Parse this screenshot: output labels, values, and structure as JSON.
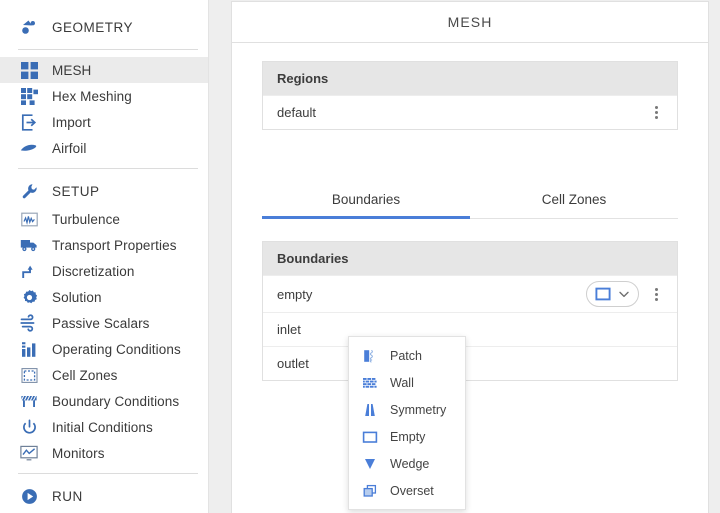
{
  "app": {
    "accent_color": "#4a7ed8",
    "icon_color": "#3a6db5",
    "highlight_color": "#ebebeb"
  },
  "sidebar": {
    "groups": [
      {
        "items": [
          {
            "label": "GEOMETRY",
            "icon": "geometry-icon",
            "section": true,
            "active": false
          }
        ]
      },
      {
        "items": [
          {
            "label": "MESH",
            "icon": "mesh-grid-icon",
            "section": false,
            "active": true
          },
          {
            "label": "Hex Meshing",
            "icon": "hex-meshing-icon",
            "section": false,
            "active": false
          },
          {
            "label": "Import",
            "icon": "import-icon",
            "section": false,
            "active": false
          },
          {
            "label": "Airfoil",
            "icon": "airfoil-icon",
            "section": false,
            "active": false
          }
        ]
      },
      {
        "items": [
          {
            "label": "SETUP",
            "icon": "wrench-icon",
            "section": true,
            "active": false
          },
          {
            "label": "Turbulence",
            "icon": "turbulence-icon",
            "section": false,
            "active": false
          },
          {
            "label": "Transport Properties",
            "icon": "truck-icon",
            "section": false,
            "active": false
          },
          {
            "label": "Discretization",
            "icon": "discretization-icon",
            "section": false,
            "active": false
          },
          {
            "label": "Solution",
            "icon": "gear-icon",
            "section": false,
            "active": false
          },
          {
            "label": "Passive Scalars",
            "icon": "wind-icon",
            "section": false,
            "active": false
          },
          {
            "label": "Operating Conditions",
            "icon": "bar-chart-icon",
            "section": false,
            "active": false
          },
          {
            "label": "Cell Zones",
            "icon": "cell-zones-icon",
            "section": false,
            "active": false
          },
          {
            "label": "Boundary Conditions",
            "icon": "barrier-icon",
            "section": false,
            "active": false
          },
          {
            "label": "Initial Conditions",
            "icon": "power-icon",
            "section": false,
            "active": false
          },
          {
            "label": "Monitors",
            "icon": "monitor-icon",
            "section": false,
            "active": false
          }
        ]
      },
      {
        "items": [
          {
            "label": "RUN",
            "icon": "play-icon",
            "section": true,
            "active": false
          }
        ]
      }
    ]
  },
  "main": {
    "title": "MESH",
    "regions_card": {
      "header": "Regions",
      "rows": [
        {
          "name": "default",
          "menu_icon": "kebab-icon"
        }
      ]
    },
    "tabs": [
      {
        "label": "Boundaries",
        "active": true
      },
      {
        "label": "Cell Zones",
        "active": false
      }
    ],
    "boundaries_card": {
      "header": "Boundaries",
      "rows": [
        {
          "name": "empty",
          "type_icon": "empty-type-icon",
          "has_select": true
        },
        {
          "name": "inlet",
          "type_icon": "",
          "has_select": false
        },
        {
          "name": "outlet",
          "type_icon": "",
          "has_select": false
        }
      ]
    },
    "type_menu": {
      "open": true,
      "items": [
        {
          "label": "Patch",
          "icon": "patch-icon"
        },
        {
          "label": "Wall",
          "icon": "wall-icon"
        },
        {
          "label": "Symmetry",
          "icon": "symmetry-icon"
        },
        {
          "label": "Empty",
          "icon": "empty-icon"
        },
        {
          "label": "Wedge",
          "icon": "wedge-icon"
        },
        {
          "label": "Overset",
          "icon": "overset-icon"
        }
      ]
    }
  }
}
